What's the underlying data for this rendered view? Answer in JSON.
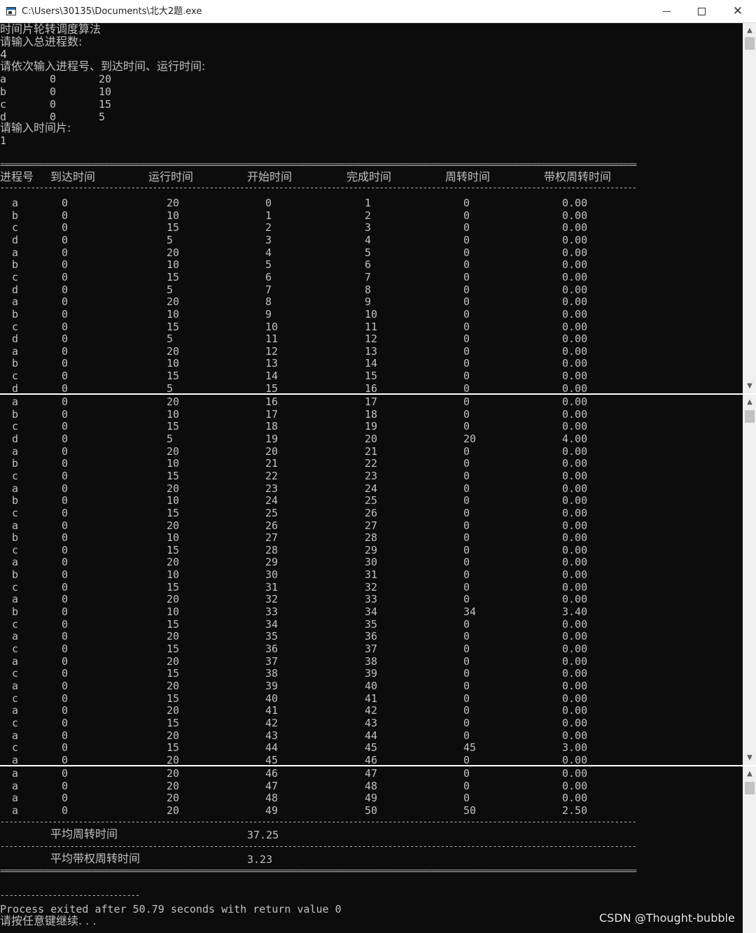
{
  "window": {
    "title": "C:\\Users\\30135\\Documents\\北大2题.exe",
    "minimize_glyph": "minimize-icon",
    "maximize_glyph": "maximize-icon",
    "close_glyph": "✕"
  },
  "console": {
    "intro": [
      "时间片轮转调度算法",
      "请输入总进程数:",
      "4",
      "请依次输入进程号、到达时间、运行时间:"
    ],
    "inputs": [
      {
        "name": "a",
        "arrive": "0",
        "run": "20"
      },
      {
        "name": "b",
        "arrive": "0",
        "run": "10"
      },
      {
        "name": "c",
        "arrive": "0",
        "run": "15"
      },
      {
        "name": "d",
        "arrive": "0",
        "run": "5"
      }
    ],
    "slice_prompt": "请输入时间片:",
    "slice_value": "1",
    "separator_double": "==================================================================================================================================================",
    "separator_single": "--------------------------------------------------------------------------------------------------------------------------------------------------",
    "headers": [
      "进程号",
      "到达时间",
      "运行时间",
      "开始时间",
      "完成时间",
      "周转时间",
      "带权周转时间"
    ],
    "rows": [
      [
        "a",
        "0",
        "20",
        "0",
        "1",
        "0",
        "0.00"
      ],
      [
        "b",
        "0",
        "10",
        "1",
        "2",
        "0",
        "0.00"
      ],
      [
        "c",
        "0",
        "15",
        "2",
        "3",
        "0",
        "0.00"
      ],
      [
        "d",
        "0",
        "5",
        "3",
        "4",
        "0",
        "0.00"
      ],
      [
        "a",
        "0",
        "20",
        "4",
        "5",
        "0",
        "0.00"
      ],
      [
        "b",
        "0",
        "10",
        "5",
        "6",
        "0",
        "0.00"
      ],
      [
        "c",
        "0",
        "15",
        "6",
        "7",
        "0",
        "0.00"
      ],
      [
        "d",
        "0",
        "5",
        "7",
        "8",
        "0",
        "0.00"
      ],
      [
        "a",
        "0",
        "20",
        "8",
        "9",
        "0",
        "0.00"
      ],
      [
        "b",
        "0",
        "10",
        "9",
        "10",
        "0",
        "0.00"
      ],
      [
        "c",
        "0",
        "15",
        "10",
        "11",
        "0",
        "0.00"
      ],
      [
        "d",
        "0",
        "5",
        "11",
        "12",
        "0",
        "0.00"
      ],
      [
        "a",
        "0",
        "20",
        "12",
        "13",
        "0",
        "0.00"
      ],
      [
        "b",
        "0",
        "10",
        "13",
        "14",
        "0",
        "0.00"
      ],
      [
        "c",
        "0",
        "15",
        "14",
        "15",
        "0",
        "0.00"
      ],
      [
        "d",
        "0",
        "5",
        "15",
        "16",
        "0",
        "0.00"
      ],
      [
        "a",
        "0",
        "20",
        "16",
        "17",
        "0",
        "0.00"
      ],
      [
        "b",
        "0",
        "10",
        "17",
        "18",
        "0",
        "0.00"
      ],
      [
        "c",
        "0",
        "15",
        "18",
        "19",
        "0",
        "0.00"
      ],
      [
        "d",
        "0",
        "5",
        "19",
        "20",
        "20",
        "4.00"
      ],
      [
        "a",
        "0",
        "20",
        "20",
        "21",
        "0",
        "0.00"
      ],
      [
        "b",
        "0",
        "10",
        "21",
        "22",
        "0",
        "0.00"
      ],
      [
        "c",
        "0",
        "15",
        "22",
        "23",
        "0",
        "0.00"
      ],
      [
        "a",
        "0",
        "20",
        "23",
        "24",
        "0",
        "0.00"
      ],
      [
        "b",
        "0",
        "10",
        "24",
        "25",
        "0",
        "0.00"
      ],
      [
        "c",
        "0",
        "15",
        "25",
        "26",
        "0",
        "0.00"
      ],
      [
        "a",
        "0",
        "20",
        "26",
        "27",
        "0",
        "0.00"
      ],
      [
        "b",
        "0",
        "10",
        "27",
        "28",
        "0",
        "0.00"
      ],
      [
        "c",
        "0",
        "15",
        "28",
        "29",
        "0",
        "0.00"
      ],
      [
        "a",
        "0",
        "20",
        "29",
        "30",
        "0",
        "0.00"
      ],
      [
        "b",
        "0",
        "10",
        "30",
        "31",
        "0",
        "0.00"
      ],
      [
        "c",
        "0",
        "15",
        "31",
        "32",
        "0",
        "0.00"
      ],
      [
        "a",
        "0",
        "20",
        "32",
        "33",
        "0",
        "0.00"
      ],
      [
        "b",
        "0",
        "10",
        "33",
        "34",
        "34",
        "3.40"
      ],
      [
        "c",
        "0",
        "15",
        "34",
        "35",
        "0",
        "0.00"
      ],
      [
        "a",
        "0",
        "20",
        "35",
        "36",
        "0",
        "0.00"
      ],
      [
        "c",
        "0",
        "15",
        "36",
        "37",
        "0",
        "0.00"
      ],
      [
        "a",
        "0",
        "20",
        "37",
        "38",
        "0",
        "0.00"
      ],
      [
        "c",
        "0",
        "15",
        "38",
        "39",
        "0",
        "0.00"
      ],
      [
        "a",
        "0",
        "20",
        "39",
        "40",
        "0",
        "0.00"
      ],
      [
        "c",
        "0",
        "15",
        "40",
        "41",
        "0",
        "0.00"
      ],
      [
        "a",
        "0",
        "20",
        "41",
        "42",
        "0",
        "0.00"
      ],
      [
        "c",
        "0",
        "15",
        "42",
        "43",
        "0",
        "0.00"
      ],
      [
        "a",
        "0",
        "20",
        "43",
        "44",
        "0",
        "0.00"
      ],
      [
        "c",
        "0",
        "15",
        "44",
        "45",
        "45",
        "3.00"
      ],
      [
        "a",
        "0",
        "20",
        "45",
        "46",
        "0",
        "0.00"
      ],
      [
        "a",
        "0",
        "20",
        "46",
        "47",
        "0",
        "0.00"
      ],
      [
        "a",
        "0",
        "20",
        "47",
        "48",
        "0",
        "0.00"
      ],
      [
        "a",
        "0",
        "20",
        "48",
        "49",
        "0",
        "0.00"
      ],
      [
        "a",
        "0",
        "20",
        "49",
        "50",
        "50",
        "2.50"
      ]
    ],
    "avg_turnaround_label": "平均周转时间",
    "avg_turnaround_value": "37.25",
    "avg_weighted_label": "平均带权周转时间",
    "avg_weighted_value": "3.23",
    "short_rule": "--------------------------------",
    "exit_message": "Process exited after 50.79 seconds with return value 0",
    "continue_prompt": "请按任意键继续. . ."
  },
  "scrollbar": {
    "up_arrow": "up-arrow-icon",
    "down_arrow": "down-arrow-icon"
  },
  "watermark": "CSDN @Thought-bubble"
}
